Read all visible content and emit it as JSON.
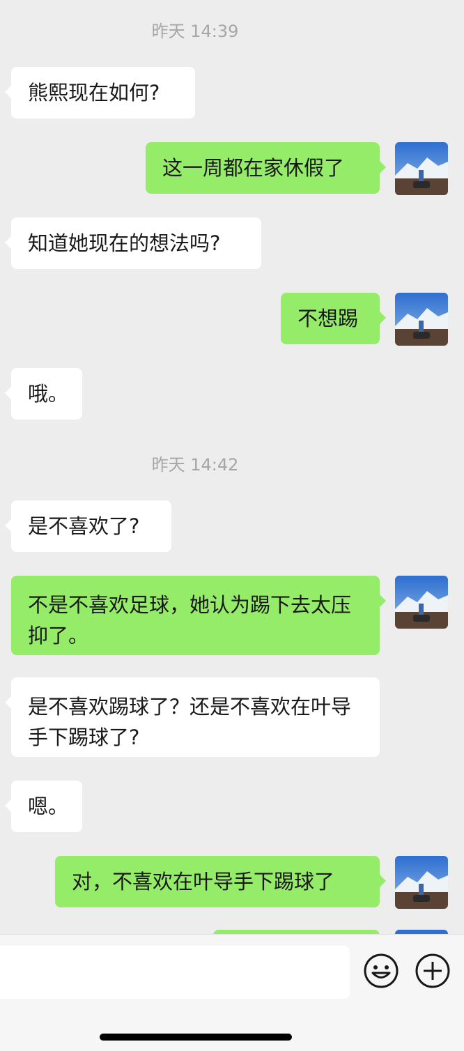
{
  "timestamps": [
    "昨天 14:39",
    "昨天 14:42"
  ],
  "messages": [
    {
      "side": "left",
      "text": "熊熙现在如何?"
    },
    {
      "side": "right",
      "text": "这一周都在家休假了"
    },
    {
      "side": "left",
      "text": "知道她现在的想法吗?"
    },
    {
      "side": "right",
      "text": "不想踢"
    },
    {
      "side": "left",
      "text": "哦。"
    },
    {
      "side": "left",
      "text": "是不喜欢了?"
    },
    {
      "side": "right",
      "text": "不是不喜欢足球，她认为踢下去太压抑了。"
    },
    {
      "side": "left",
      "text": "是不喜欢踢球了？还是不喜欢在叶导手下踢球了?"
    },
    {
      "side": "left",
      "text": "嗯。"
    },
    {
      "side": "right",
      "text": "对，不喜欢在叶导手下踢球了"
    }
  ],
  "input": {
    "value": "",
    "placeholder": ""
  },
  "icons": {
    "emoji": "emoji-icon",
    "add": "plus-icon",
    "avatar": "avatar-mountain-photo"
  },
  "colors": {
    "background": "#ededed",
    "incoming_bubble": "#ffffff",
    "outgoing_bubble": "#95ec69",
    "timestamp_text": "#a6a6a6",
    "message_text": "#191919"
  }
}
